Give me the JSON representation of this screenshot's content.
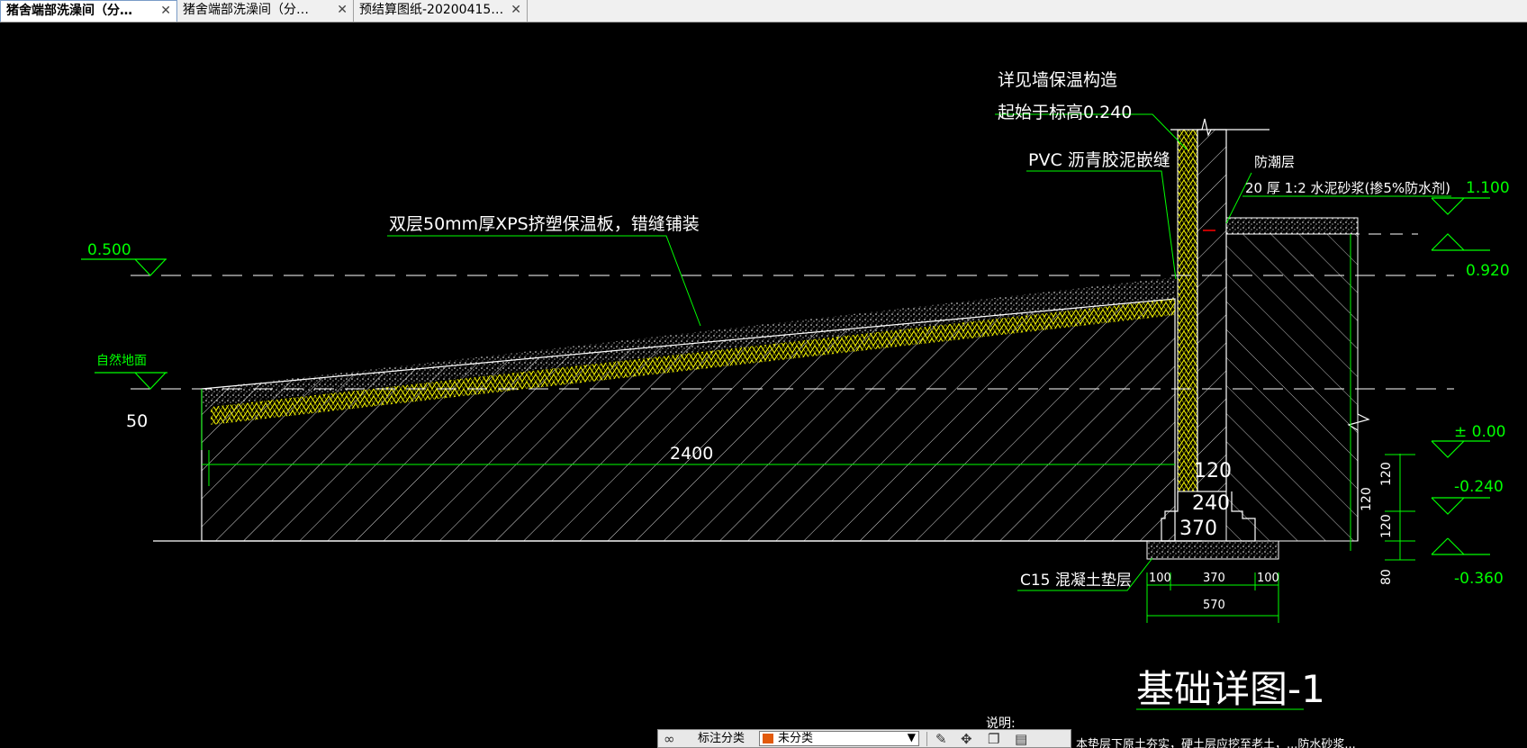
{
  "tabs": [
    {
      "label": "猪舍端部洗澡间（分…",
      "active": true
    },
    {
      "label": "猪舍端部洗澡间（分…",
      "active": false
    },
    {
      "label": "预结算图纸-20200415…",
      "active": false
    }
  ],
  "drawing": {
    "title": "基础详图-1",
    "note_heading": "说明:",
    "annotations": {
      "wall_insulation": "详见墙保温构造",
      "start_elevation": "起始于标高0.240",
      "pvc_joint": "PVC 沥青胶泥嵌缝",
      "damp_proof": "防潮层",
      "mortar": "20 厚 1:2 水泥砂浆(掺5%防水剂)",
      "xps_board": "双层50mm厚XPS挤塑保温板，错缝铺装",
      "natural_ground": "自然地面",
      "concrete_pad": "C15 混凝土垫层"
    },
    "elevations": {
      "e_0500": "0.500",
      "e_1100": "1.100",
      "e_0920": "0.920",
      "e_000": "± 0.00",
      "e_m0240": "-0.240",
      "e_m0360": "-0.360"
    },
    "dimensions": {
      "d_50": "50",
      "d_2400": "2400",
      "d_120_wall": "120",
      "d_240": "240",
      "d_370": "370",
      "d_120_a": "120",
      "d_120_b": "120",
      "d_120_c": "120",
      "d_80": "80",
      "d_100_left": "100",
      "d_370_bottom": "370",
      "d_100_right": "100",
      "d_570": "570"
    },
    "bottom_text": "本垫层下原土夯实，硬土层应挖至老土，...防水砂浆..."
  },
  "toolbar": {
    "label": "标注分类",
    "selected": "未分类"
  },
  "colors": {
    "background": "#000000",
    "line_white": "#ffffff",
    "line_green": "#00ff00",
    "insulation_yellow": "#ffff00"
  }
}
